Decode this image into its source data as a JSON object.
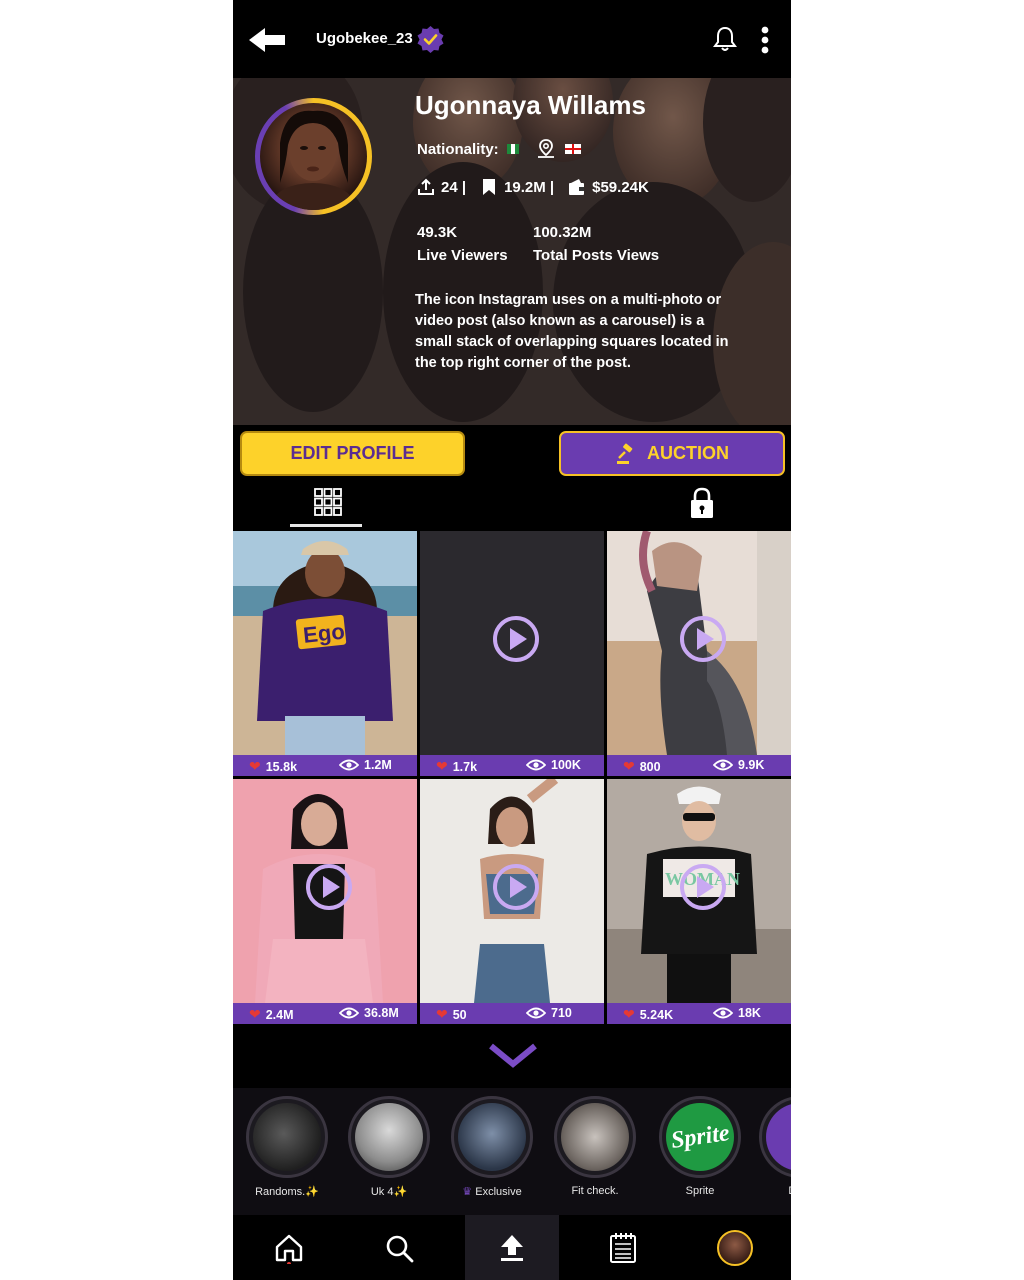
{
  "header": {
    "username": "Ugobekee_23",
    "icons": [
      "back-arrow-icon",
      "verified-badge-icon",
      "bell-icon",
      "more-vertical-icon"
    ]
  },
  "profile": {
    "name": "Ugonnaya Willams",
    "nationality_label": "Nationality:",
    "uploads": "24 |",
    "saves": "19.2M |",
    "earnings": "$59.24K",
    "live_viewers_value": "49.3K",
    "live_viewers_label": "Live Viewers",
    "post_views_value": "100.32M",
    "post_views_label": "Total Posts Views",
    "bio": "The icon Instagram uses on a multi-photo or video post (also known as a carousel) is a small stack of overlapping squares located in the top right corner of the post."
  },
  "actions": {
    "edit_label": "EDIT PROFILE",
    "auction_label": "AUCTION"
  },
  "colors": {
    "accent_purple": "#6a3cb0",
    "accent_yellow": "#fdd22a",
    "heart_red": "#e53935"
  },
  "posts": [
    {
      "likes": "15.8k",
      "views": "1.2M",
      "video": false
    },
    {
      "likes": "1.7k",
      "views": "100K",
      "video": true
    },
    {
      "likes": "800",
      "views": "9.9K",
      "video": true
    },
    {
      "likes": "2.4M",
      "views": "36.8M",
      "video": true
    },
    {
      "likes": "50",
      "views": "710",
      "video": true
    },
    {
      "likes": "5.24K",
      "views": "18K",
      "video": true
    }
  ],
  "post_art": {
    "ego_text": "Ego",
    "woman_text": "WOMAN"
  },
  "highlights": [
    {
      "label": "Randoms.✨"
    },
    {
      "label": "Uk 4✨"
    },
    {
      "label": "Exclusive"
    },
    {
      "label": "Fit check."
    },
    {
      "label": "Sprite",
      "logo_text": "Sprite"
    },
    {
      "label": "Dark"
    }
  ],
  "nav": [
    "home-icon",
    "search-icon",
    "upload-icon",
    "calendar-list-icon",
    "profile-avatar"
  ]
}
